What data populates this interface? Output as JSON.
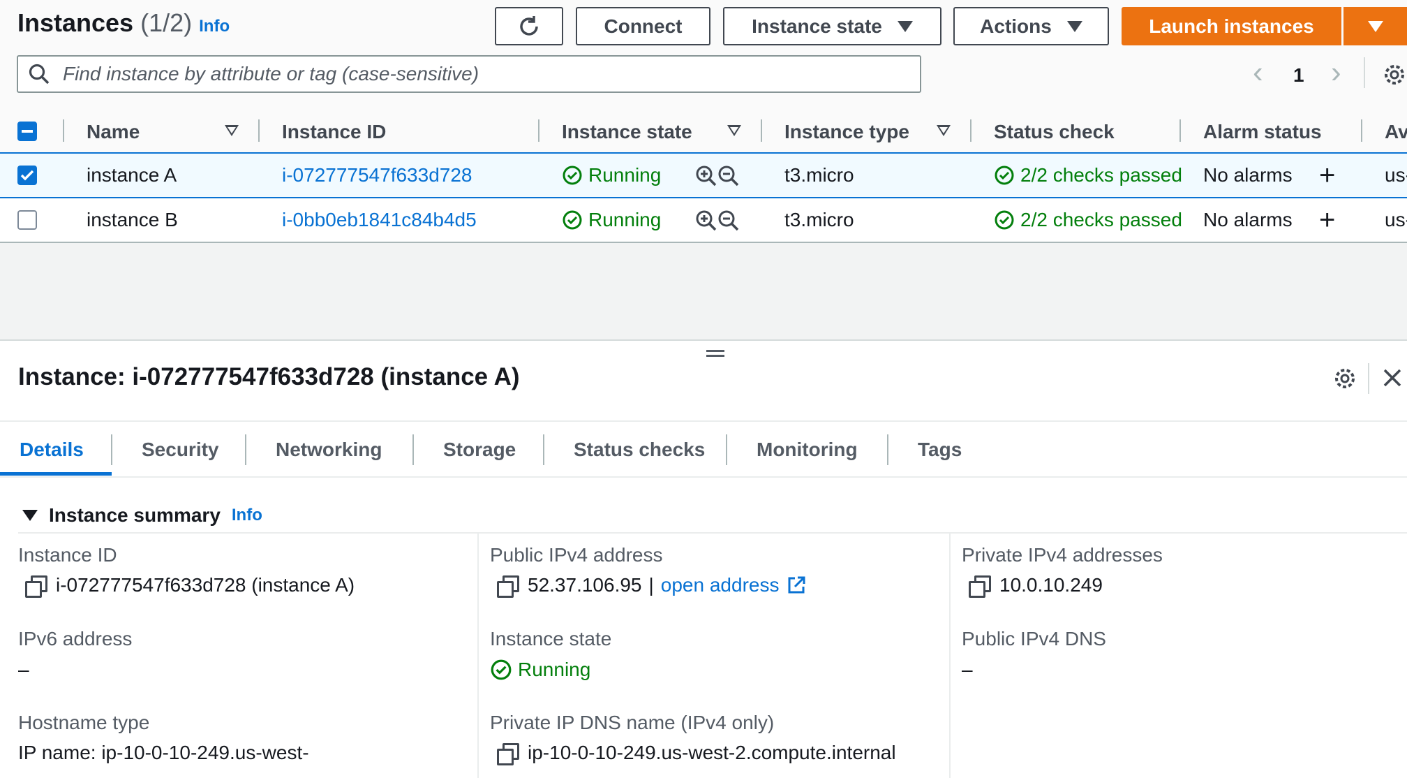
{
  "header": {
    "title": "Instances",
    "count": "(1/2)",
    "info": "Info"
  },
  "toolbar": {
    "connect": "Connect",
    "instance_state": "Instance state",
    "actions": "Actions",
    "launch": "Launch instances"
  },
  "search": {
    "placeholder": "Find instance by attribute or tag (case-sensitive)"
  },
  "pagination": {
    "page": "1"
  },
  "table": {
    "columns": [
      "Name",
      "Instance ID",
      "Instance state",
      "Instance type",
      "Status check",
      "Alarm status",
      "Av"
    ],
    "rows": [
      {
        "name": "instance A",
        "id": "i-072777547f633d728",
        "state": "Running",
        "type": "t3.micro",
        "status": "2/2 checks passed",
        "alarm": "No alarms",
        "az": "us-",
        "selected": true
      },
      {
        "name": "instance B",
        "id": "i-0bb0eb1841c84b4d5",
        "state": "Running",
        "type": "t3.micro",
        "status": "2/2 checks passed",
        "alarm": "No alarms",
        "az": "us-",
        "selected": false
      }
    ]
  },
  "panel": {
    "title": "Instance: i-072777547f633d728 (instance A)",
    "tabs": [
      "Details",
      "Security",
      "Networking",
      "Storage",
      "Status checks",
      "Monitoring",
      "Tags"
    ],
    "section": {
      "title": "Instance summary",
      "info": "Info"
    },
    "fields": {
      "instance_id": {
        "label": "Instance ID",
        "value": "i-072777547f633d728 (instance A)"
      },
      "ipv6": {
        "label": "IPv6 address",
        "value": "–"
      },
      "hostname": {
        "label": "Hostname type",
        "value": "IP name: ip-10-0-10-249.us-west-"
      },
      "public_ipv4": {
        "label": "Public IPv4 address",
        "value": "52.37.106.95",
        "sep": "|",
        "link": "open address"
      },
      "state": {
        "label": "Instance state",
        "value": "Running"
      },
      "private_dns": {
        "label": "Private IP DNS name (IPv4 only)",
        "value": "ip-10-0-10-249.us-west-2.compute.internal"
      },
      "private_ipv4": {
        "label": "Private IPv4 addresses",
        "value": "10.0.10.249"
      },
      "public_dns": {
        "label": "Public IPv4 DNS",
        "value": "–"
      }
    }
  },
  "colors": {
    "accent": "#0972d3",
    "launch": "#ec7211",
    "success": "#037f0c"
  }
}
